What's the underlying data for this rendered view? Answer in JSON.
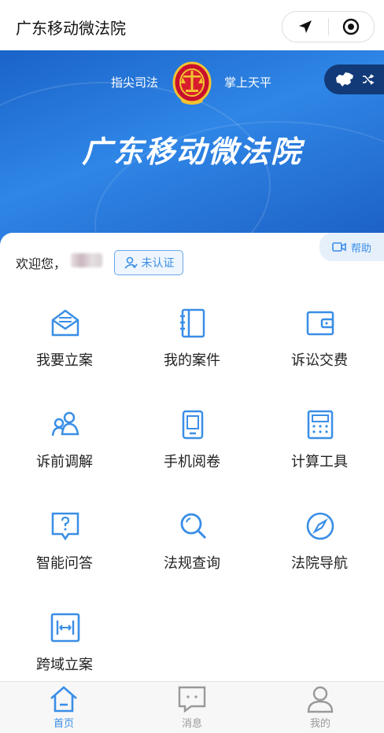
{
  "header": {
    "title": "广东移动微法院"
  },
  "banner": {
    "slogan_left": "指尖司法",
    "slogan_right": "掌上天平",
    "title": "广东移动微法院"
  },
  "help": {
    "label": "帮助"
  },
  "user": {
    "welcome": "欢迎您，",
    "auth_status": "未认证"
  },
  "services": [
    {
      "label": "我要立案",
      "icon": "envelope-icon"
    },
    {
      "label": "我的案件",
      "icon": "folder-icon"
    },
    {
      "label": "诉讼交费",
      "icon": "wallet-icon"
    },
    {
      "label": "诉前调解",
      "icon": "people-icon"
    },
    {
      "label": "手机阅卷",
      "icon": "phone-icon"
    },
    {
      "label": "计算工具",
      "icon": "calculator-icon"
    },
    {
      "label": "智能问答",
      "icon": "question-bubble-icon"
    },
    {
      "label": "法规查询",
      "icon": "magnifier-icon"
    },
    {
      "label": "法院导航",
      "icon": "compass-icon"
    },
    {
      "label": "跨域立案",
      "icon": "cross-region-icon"
    }
  ],
  "tabbar": [
    {
      "label": "首页",
      "icon": "home-icon",
      "active": true
    },
    {
      "label": "消息",
      "icon": "message-icon",
      "active": false
    },
    {
      "label": "我的",
      "icon": "user-icon",
      "active": false
    }
  ],
  "colors": {
    "accent": "#3a8ee6",
    "banner": "#2f86e6",
    "dark_pill": "#123a78"
  }
}
